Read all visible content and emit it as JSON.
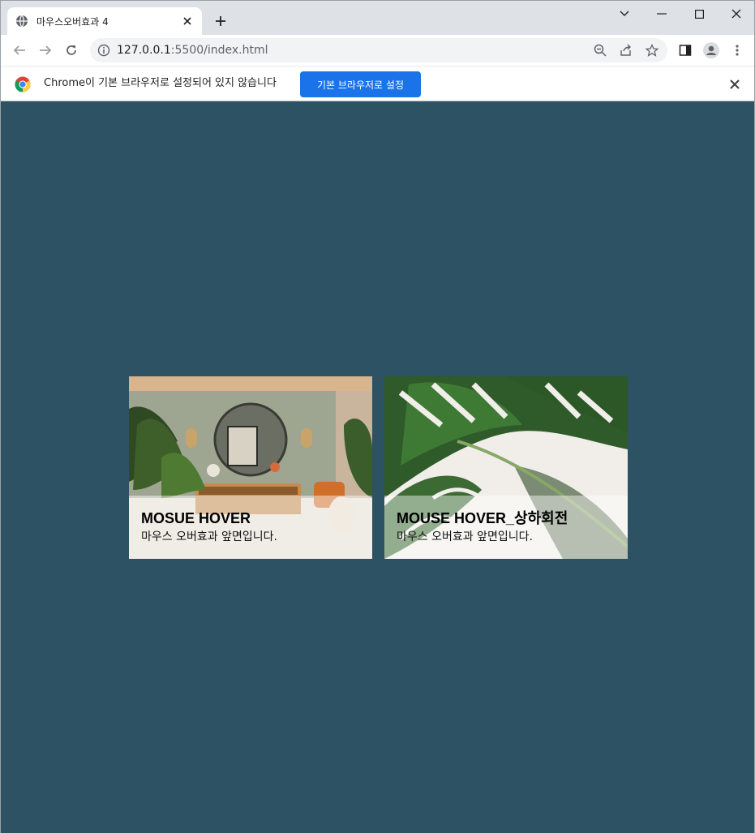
{
  "browser": {
    "tab_title": "마우스오버효과 4",
    "url_host": "127.0.0.1",
    "url_rest": ":5500/index.html",
    "infobar_message": "Chrome이 기본 브라우저로 설정되어 있지 않습니다",
    "infobar_button": "기본 브라우저로 설정"
  },
  "cards": [
    {
      "title": "MOSUE HOVER",
      "subtitle": "마우스 오버효과 앞면입니다."
    },
    {
      "title": "MOUSE HOVER_상하회전",
      "subtitle": "마우스 오버효과 앞면입니다."
    }
  ],
  "colors": {
    "page_background": "#2c5263",
    "infobar_button": "#1a73e8",
    "titlebar": "#dee1e6"
  },
  "icons": [
    "globe-icon",
    "close-icon",
    "plus-icon",
    "chevron-down-icon",
    "minimize-icon",
    "maximize-icon",
    "back-icon",
    "forward-icon",
    "reload-icon",
    "info-icon",
    "zoom-out-icon",
    "share-icon",
    "star-icon",
    "side-panel-icon",
    "profile-icon",
    "more-icon",
    "chrome-logo-icon"
  ]
}
